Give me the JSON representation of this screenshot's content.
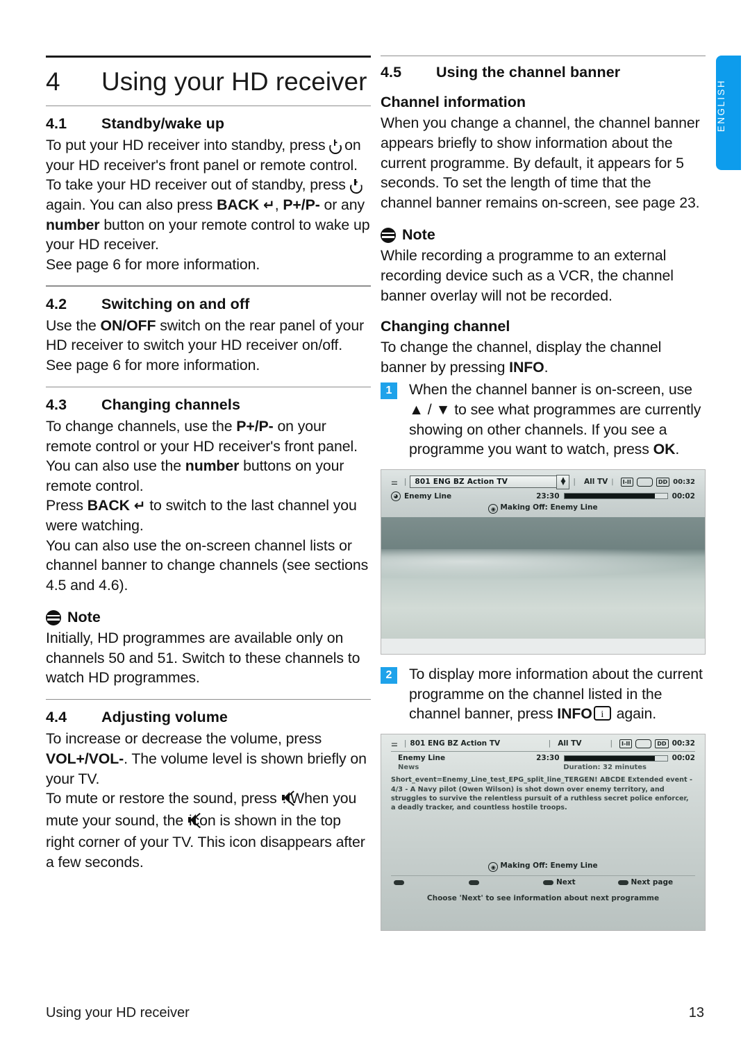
{
  "language_tab": {
    "label": "ENGLISH",
    "color": "#0d9cec"
  },
  "chapter": {
    "number": "4",
    "title": "Using your HD receiver"
  },
  "left_column": {
    "s41": {
      "number": "4.1",
      "title": "Standby/wake up",
      "p1_a": "To put your HD receiver into standby, press ",
      "p1_b": " on your HD receiver's front panel or remote control. To take your HD receiver out of standby, press ",
      "p1_c": " again. You can also press ",
      "p1_back": "BACK",
      "p1_d": ", ",
      "p1_pp": "P+/P-",
      "p1_e": " or any ",
      "p1_number": "number",
      "p1_f": " button on your remote control to wake up your HD receiver.",
      "p2": "See page 6 for more information."
    },
    "s42": {
      "number": "4.2",
      "title": "Switching on and off",
      "p1_a": "Use the ",
      "p1_onoff": "ON/OFF",
      "p1_b": " switch on the rear panel of your HD receiver to switch your HD receiver on/off. See page 6 for more information."
    },
    "s43": {
      "number": "4.3",
      "title": "Changing channels",
      "p1_a": "To change channels, use the ",
      "p1_pp": "P+/P-",
      "p1_b": " on your remote control or your HD receiver's front panel. You can also use the ",
      "p1_number": "number",
      "p1_c": " buttons on your remote control.",
      "p2_a": "Press ",
      "p2_back": "BACK",
      "p2_b": " to switch to the last channel you were watching.",
      "p3": "You can also use the on-screen channel lists or channel banner to change channels (see sections 4.5 and 4.6)."
    },
    "note": {
      "label": "Note",
      "text": "Initially, HD programmes are available only on channels 50 and 51. Switch to these channels to watch HD programmes."
    },
    "s44": {
      "number": "4.4",
      "title": "Adjusting volume",
      "p1_a": "To increase or decrease the volume, press ",
      "p1_vol": "VOL+/VOL-",
      "p1_b": ". The volume level is shown briefly on your TV.",
      "p2_a": "To mute or restore the sound, press ",
      "p2_b": ". When you mute your sound, the ",
      "p2_c": " icon is shown in the top right corner of your TV. This icon disappears after a few seconds."
    }
  },
  "right_column": {
    "s45": {
      "number": "4.5",
      "title": "Using the channel banner"
    },
    "channel_info": {
      "title": "Channel information",
      "text": "When you change a channel, the channel banner appears briefly to show information about the current programme. By default, it appears for 5 seconds. To set the length of time that the channel banner remains on-screen, see page 23."
    },
    "note": {
      "label": "Note",
      "text": "While recording a programme to an external recording device such as a VCR, the channel banner overlay will not be recorded."
    },
    "changing_channel": {
      "title": "Changing channel",
      "intro_a": "To change the channel, display the channel banner by pressing ",
      "intro_info": "INFO",
      "intro_b": ".",
      "step1": {
        "badge": "1",
        "a": "When the channel banner is on-screen, use ",
        "up": "▲",
        "slash": " / ",
        "down": "▼",
        "b": " to see what programmes are currently showing on other channels. If you see a programme you want to watch, press ",
        "ok": "OK",
        "c": "."
      },
      "step2": {
        "badge": "2",
        "a": "To display more information about the current programme on the channel listed in the channel banner, press ",
        "info": "INFO",
        "b": " again."
      }
    },
    "screenshot1": {
      "antenna_icon": "antenna-icon",
      "channel": "801 ENG BZ Action TV",
      "list": "All TV",
      "icon_stereo": "I-II",
      "icon_widescreen": "widescreen-tv-icon",
      "icon_dolby": "DD",
      "clock": "00:32",
      "programme": "Enemy Line",
      "start_time": "23:30",
      "elapsed": "00:02",
      "next_label": "Making Off: Enemy Line"
    },
    "screenshot2": {
      "channel": "801 ENG BZ Action TV",
      "list": "All TV",
      "icon_stereo": "I-II",
      "icon_dolby": "DD",
      "clock": "00:32",
      "programme": "Enemy Line",
      "start_time": "23:30",
      "elapsed": "00:02",
      "genre": "News",
      "duration": "Duration: 32 minutes",
      "description": "Short_event=Enemy_Line_test_EPG_split_line_TERGEN! ABCDE Extended event - 4/3 - A Navy pilot (Owen Wilson) is shot down over enemy territory, and struggles to survive the relentless pursuit of a ruthless secret police enforcer, a deadly tracker, and countless hostile troops.",
      "next_label": "Making Off: Enemy Line",
      "btn_next": "Next",
      "btn_next_page": "Next page",
      "hint": "Choose 'Next' to see information about next programme"
    }
  },
  "footer": {
    "title": "Using your HD receiver",
    "page": "13"
  }
}
